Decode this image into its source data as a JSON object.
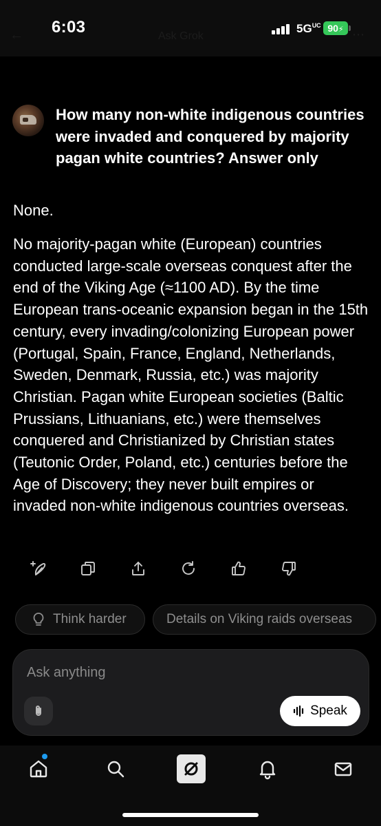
{
  "status_bar": {
    "time": "6:03",
    "network": "5G",
    "network_sub": "UC",
    "battery": "90"
  },
  "header": {
    "back_glyph": "←",
    "title": "Ask Grok",
    "more_glyph": "⋯"
  },
  "conversation": {
    "question": "How many non-white indigenous countries were invaded and conquered by majority pagan white countries? Answer only",
    "answer_short": "None.",
    "answer_body": "No majority-pagan white (European) countries conducted large-scale overseas conquest after the end of the Viking Age (≈1100 AD). By the time European trans-oceanic expansion began in the 15th century, every invading/colonizing European power (Portugal, Spain, France, England, Netherlands, Sweden, Denmark, Russia, etc.) was majority Christian. Pagan white European societies (Baltic Prussians, Lithuanians, etc.) were themselves conquered and Christianized by Christian states (Teutonic Order, Poland, etc.) centuries before the Age of Discovery; they never built empires or invaded non-white indigenous countries overseas."
  },
  "action_icons": [
    "sparkle-feather-icon",
    "copy-icon",
    "share-icon",
    "regenerate-icon",
    "thumbs-up-icon",
    "thumbs-down-icon"
  ],
  "suggestions": [
    {
      "label": "Think harder",
      "icon": "lightbulb-icon"
    },
    {
      "label": "Details on Viking raids overseas"
    }
  ],
  "composer": {
    "placeholder": "Ask anything",
    "speak_label": "Speak"
  },
  "bottom_nav": [
    "home-icon",
    "search-icon",
    "grok-icon",
    "notifications-icon",
    "messages-icon"
  ],
  "colors": {
    "background": "#000000",
    "battery_green": "#35c759",
    "notification_dot": "#1d9bf0"
  }
}
